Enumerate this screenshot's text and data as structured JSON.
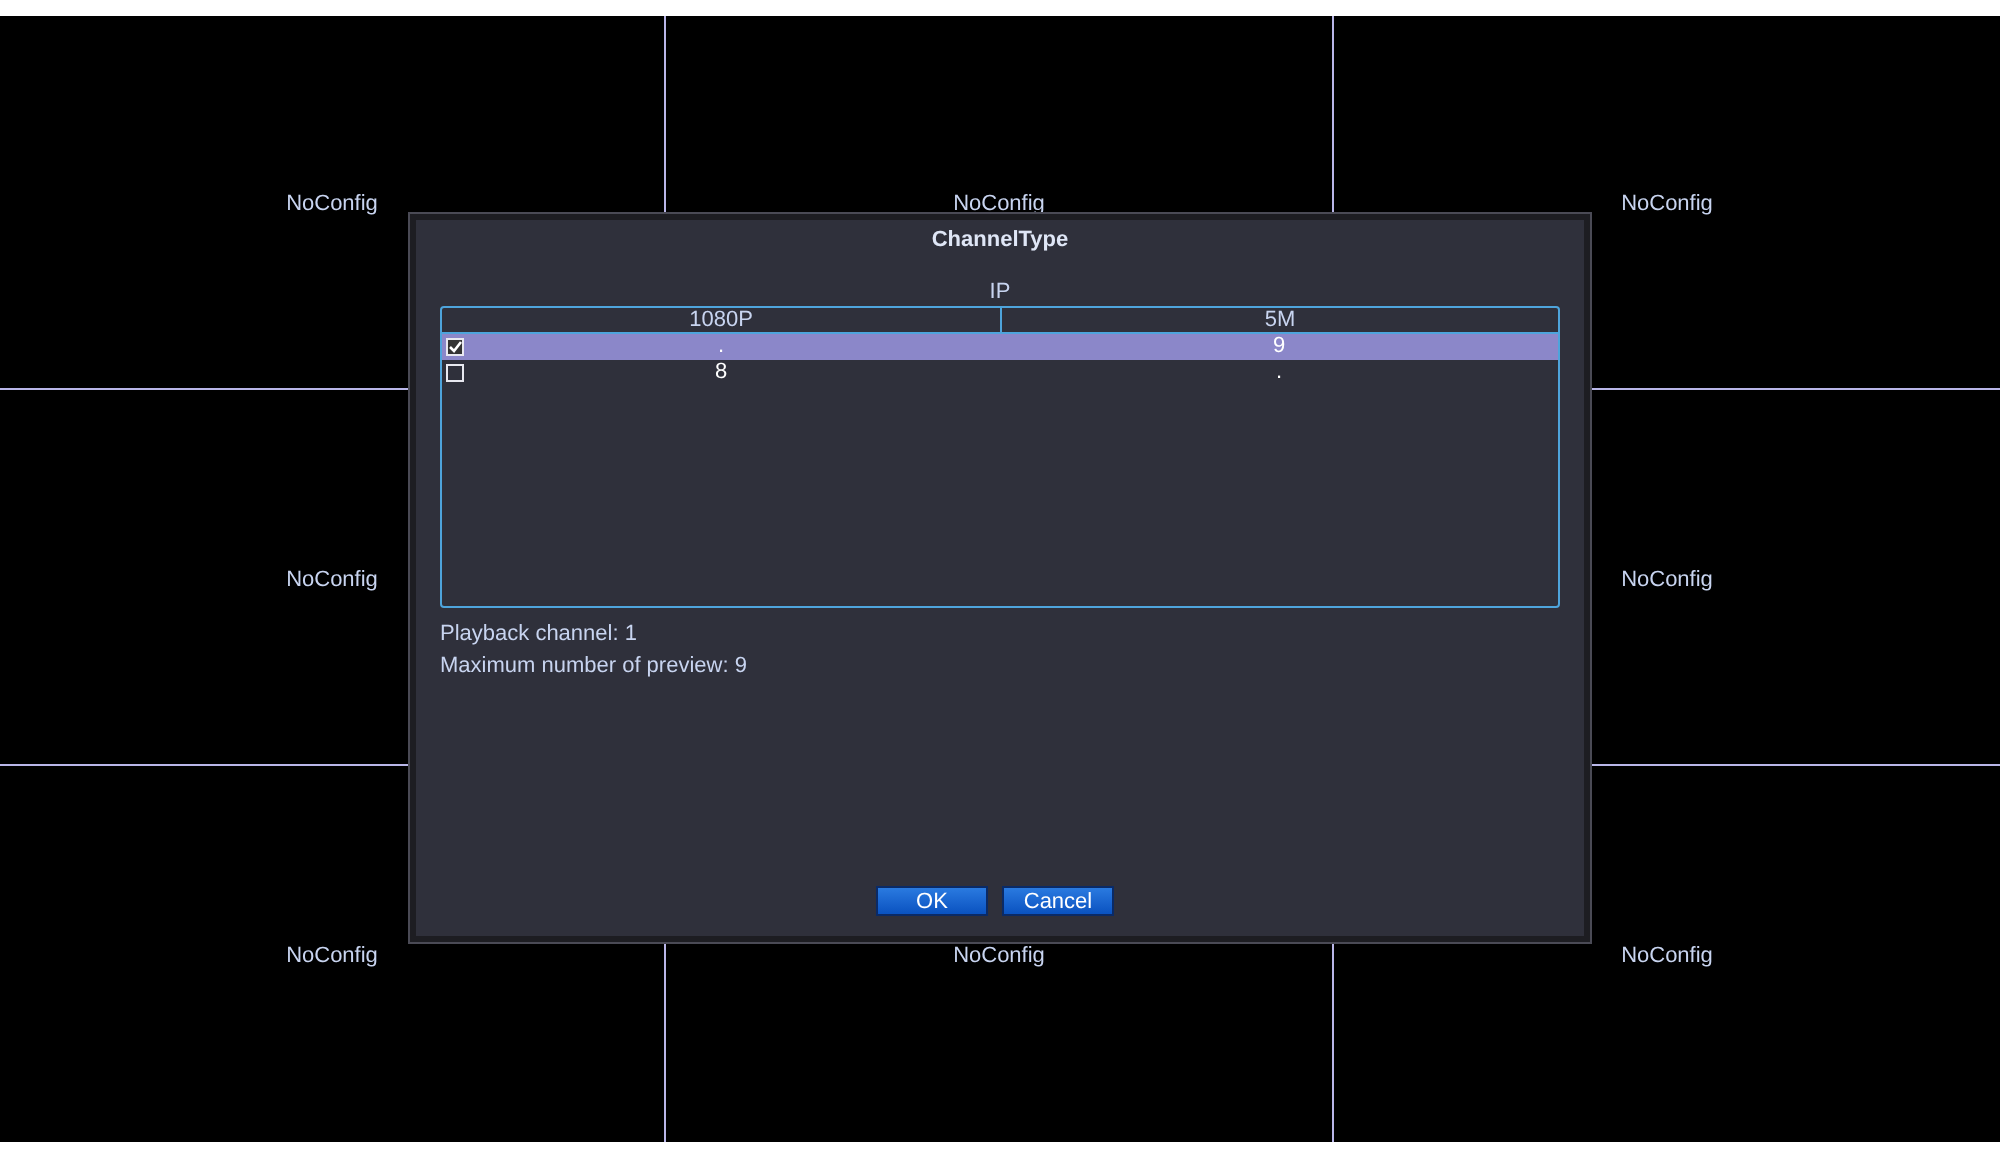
{
  "cells": [
    {
      "label": "NoConfig"
    },
    {
      "label": "NoConfig"
    },
    {
      "label": "NoConfig"
    },
    {
      "label": "NoConfig"
    },
    {},
    {
      "label": "NoConfig"
    },
    {
      "label": "NoConfig"
    },
    {
      "label": "NoConfig"
    },
    {
      "label": "NoConfig"
    }
  ],
  "dialog": {
    "title": "ChannelType",
    "group_label": "IP",
    "table": {
      "columns": [
        "1080P",
        "5M"
      ],
      "rows": [
        {
          "checked": true,
          "selected": true,
          "cells": [
            ".",
            "9"
          ]
        },
        {
          "checked": false,
          "selected": false,
          "cells": [
            "8",
            "."
          ]
        }
      ]
    },
    "info": [
      "Playback channel: 1",
      "Maximum number of preview: 9"
    ],
    "buttons": [
      "OK",
      "Cancel"
    ]
  }
}
